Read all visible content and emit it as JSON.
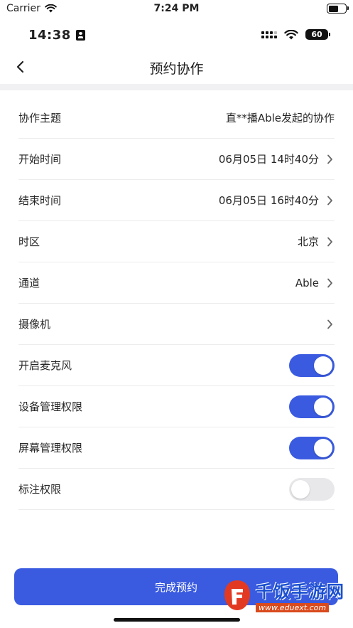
{
  "sim_status": {
    "carrier": "Carrier",
    "time": "7:24 PM"
  },
  "device_status": {
    "time": "14:38",
    "battery": "60"
  },
  "nav": {
    "title": "预约协作"
  },
  "rows": [
    {
      "label": "协作主题",
      "value": "直**播Able发起的协作",
      "chevron": false
    },
    {
      "label": "开始时间",
      "value": "06月05日  14时40分",
      "chevron": true
    },
    {
      "label": "结束时间",
      "value": "06月05日  16时40分",
      "chevron": true
    },
    {
      "label": "时区",
      "value": "北京",
      "chevron": true
    },
    {
      "label": "通道",
      "value": "Able",
      "chevron": true
    },
    {
      "label": "摄像机",
      "value": "",
      "chevron": true
    }
  ],
  "toggles": [
    {
      "label": "开启麦克风",
      "on": true
    },
    {
      "label": "设备管理权限",
      "on": true
    },
    {
      "label": "屏幕管理权限",
      "on": true
    },
    {
      "label": "标注权限",
      "on": false
    }
  ],
  "footer": {
    "done_label": "完成预约"
  },
  "watermark": {
    "main": "千饭手游网",
    "url": "www.eduext.com"
  },
  "colors": {
    "accent": "#3a5be0",
    "toggle_off": "#e8e8ea",
    "divider": "#ececee"
  }
}
